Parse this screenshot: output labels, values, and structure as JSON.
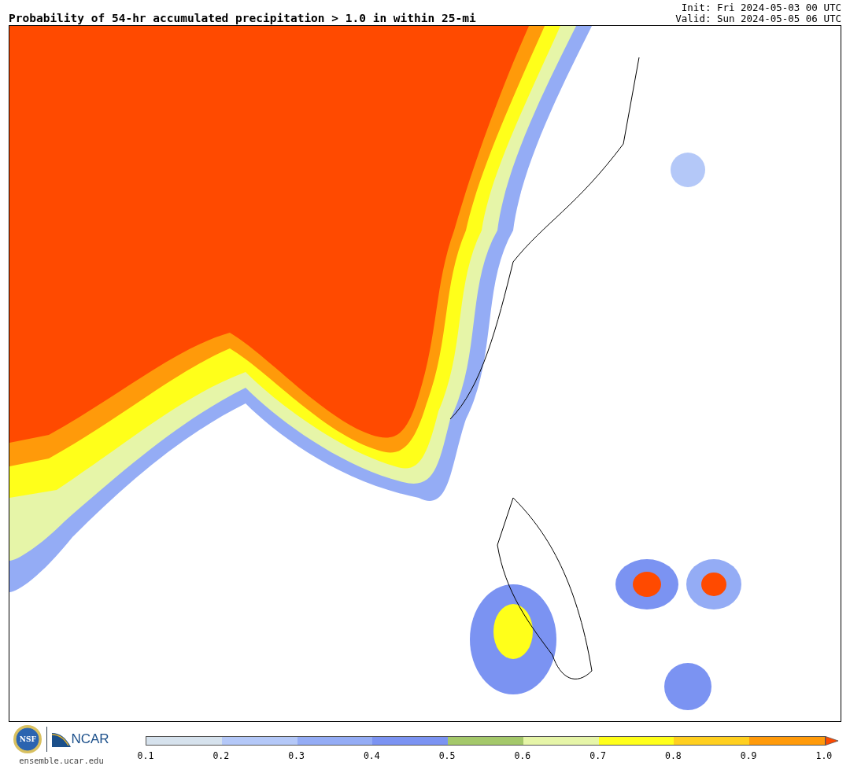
{
  "title": "Probability of 54-hr accumulated precipitation > 1.0 in within 25-mi",
  "init": "Init: Fri 2024-05-03 00 UTC",
  "valid": "Valid: Sun 2024-05-05 06 UTC",
  "logos": {
    "nsf": "NSF",
    "ncar": "NCAR",
    "url": "ensemble.ucar.edu"
  },
  "colorbar": {
    "bins": [
      {
        "color": "#d6e2ed"
      },
      {
        "color": "#b4c8f8"
      },
      {
        "color": "#94acf5"
      },
      {
        "color": "#7b93f2"
      },
      {
        "color": "#a4c86a"
      },
      {
        "color": "#e6f5a8"
      },
      {
        "color": "#ffff1a"
      },
      {
        "color": "#ffcf1f"
      },
      {
        "color": "#ff9a0a"
      }
    ],
    "extend": {
      "color": "#ff4a00"
    },
    "labels": [
      "0.1",
      "0.2",
      "0.3",
      "0.4",
      "0.5",
      "0.6",
      "0.7",
      "0.8",
      "0.9",
      "1.0"
    ]
  }
}
